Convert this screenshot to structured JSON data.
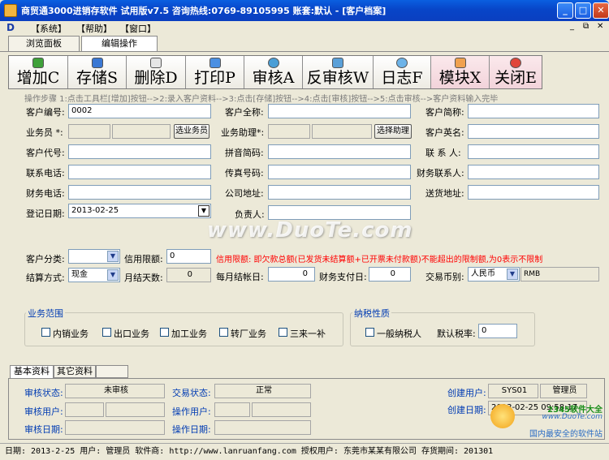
{
  "window": {
    "title": "商贸通3000进销存软件 试用版v7.5 咨询热线:0769-89105995 账套:默认 - [客户档案]",
    "min": "_",
    "max": "□",
    "close": "✕"
  },
  "menu": {
    "items": [
      "【系统】",
      "【帮助】",
      "【窗口】"
    ],
    "mdi": [
      "_",
      "₿",
      "✕"
    ]
  },
  "mode_tabs": [
    "浏览面板",
    "编辑操作"
  ],
  "toolbar": [
    {
      "label": "增加C",
      "icon": "add-icon",
      "color": "#3FA13A"
    },
    {
      "label": "存储S",
      "icon": "save-icon",
      "color": "#3A78D4"
    },
    {
      "label": "删除D",
      "icon": "delete-icon",
      "color": "#E6E6E6"
    },
    {
      "label": "打印P",
      "icon": "print-icon",
      "color": "#4A8FE2"
    },
    {
      "label": "审核A",
      "icon": "approve-icon",
      "color": "#4A9ED6"
    },
    {
      "label": "反审核W",
      "icon": "unapprove-icon",
      "color": "#5AA0D8"
    },
    {
      "label": "日志F",
      "icon": "log-icon",
      "color": "#6DB3E8"
    },
    {
      "label": "模块X",
      "icon": "module-icon",
      "color": "#F0A14E"
    },
    {
      "label": "关闭E",
      "icon": "close-icon",
      "color": "#E0463A"
    }
  ],
  "steps": "操作步骤 1:点击工具栏[增加]按钮-->2:录入客户资料-->3:点击[存储]按钮-->4:点击[审核]按钮-->5:点击审核-->客户资料输入完毕",
  "form": {
    "customer_no_label": "客户编号:",
    "customer_no": "0002",
    "full_name_label": "客户全称:",
    "short_name_label": "客户简称:",
    "salesman_label": "业务员 *:",
    "select_salesman": "选业务员",
    "assistant_label": "业务助理*:",
    "select_assistant": "选择助理",
    "english_name_label": "客户英名:",
    "code_label": "客户代号:",
    "pinyin_label": "拼音简码:",
    "contact_label": "联 系 人:",
    "phone_label": "联系电话:",
    "fax_label": "传真号码:",
    "fin_contact_label": "财务联系人:",
    "fin_phone_label": "财务电话:",
    "address_label": "公司地址:",
    "delivery_label": "送货地址:",
    "reg_date_label": "登记日期:",
    "reg_date": "2013-02-25",
    "owner_label": "负责人:",
    "category_label": "客户分类:",
    "credit_label": "信用限额:",
    "credit_value": "0",
    "credit_note": "信用限额: 即欠款总额(已发货未结算额+已开票未付款额)不能超出的限制额,为0表示不限制",
    "settle_label": "结算方式:",
    "settle_value": "现金",
    "monthly_days_label": "月结天数:",
    "monthly_days_value": "0",
    "monthly_settle_label": "每月结帐日:",
    "monthly_settle_value": "0",
    "fin_pay_label": "财务支付日:",
    "fin_pay_value": "0",
    "currency_label": "交易币别:",
    "currency_value": "人民币",
    "currency_code": "RMB"
  },
  "business_scope": {
    "title": "业务范围",
    "options": [
      "内销业务",
      "出口业务",
      "加工业务",
      "转厂业务",
      "三来一补"
    ]
  },
  "tax": {
    "title": "纳税性质",
    "general_taxpayer": "一般纳税人",
    "rate_label": "默认税率:",
    "rate_value": "0"
  },
  "bottom_tabs": [
    "基本资料",
    "其它资料"
  ],
  "bottom": {
    "approve_status_label": "审核状态:",
    "approve_status": "未审核",
    "trade_status_label": "交易状态:",
    "trade_status": "正常",
    "approve_user_label": "审核用户:",
    "operator_label": "操作用户:",
    "approve_date_label": "审核日期:",
    "operate_date_label": "操作日期:",
    "create_user_label": "创建用户:",
    "create_user_code": "SYS01",
    "create_user_name": "管理员",
    "create_date_label": "创建日期:",
    "create_date": "2013-02-25 09:58:17"
  },
  "status_bar": "日期: 2013-2-25   用户: 管理员   软件商: http://www.lanruanfang.com 授权用户: 东莞市某某有限公司 存货期间: 201301",
  "watermarks": {
    "center": "www.DuoTe.com",
    "corner_1": "2345软件大全",
    "corner_2": "www.DuoTe.com",
    "corner_3": "国内最安全的软件站"
  }
}
